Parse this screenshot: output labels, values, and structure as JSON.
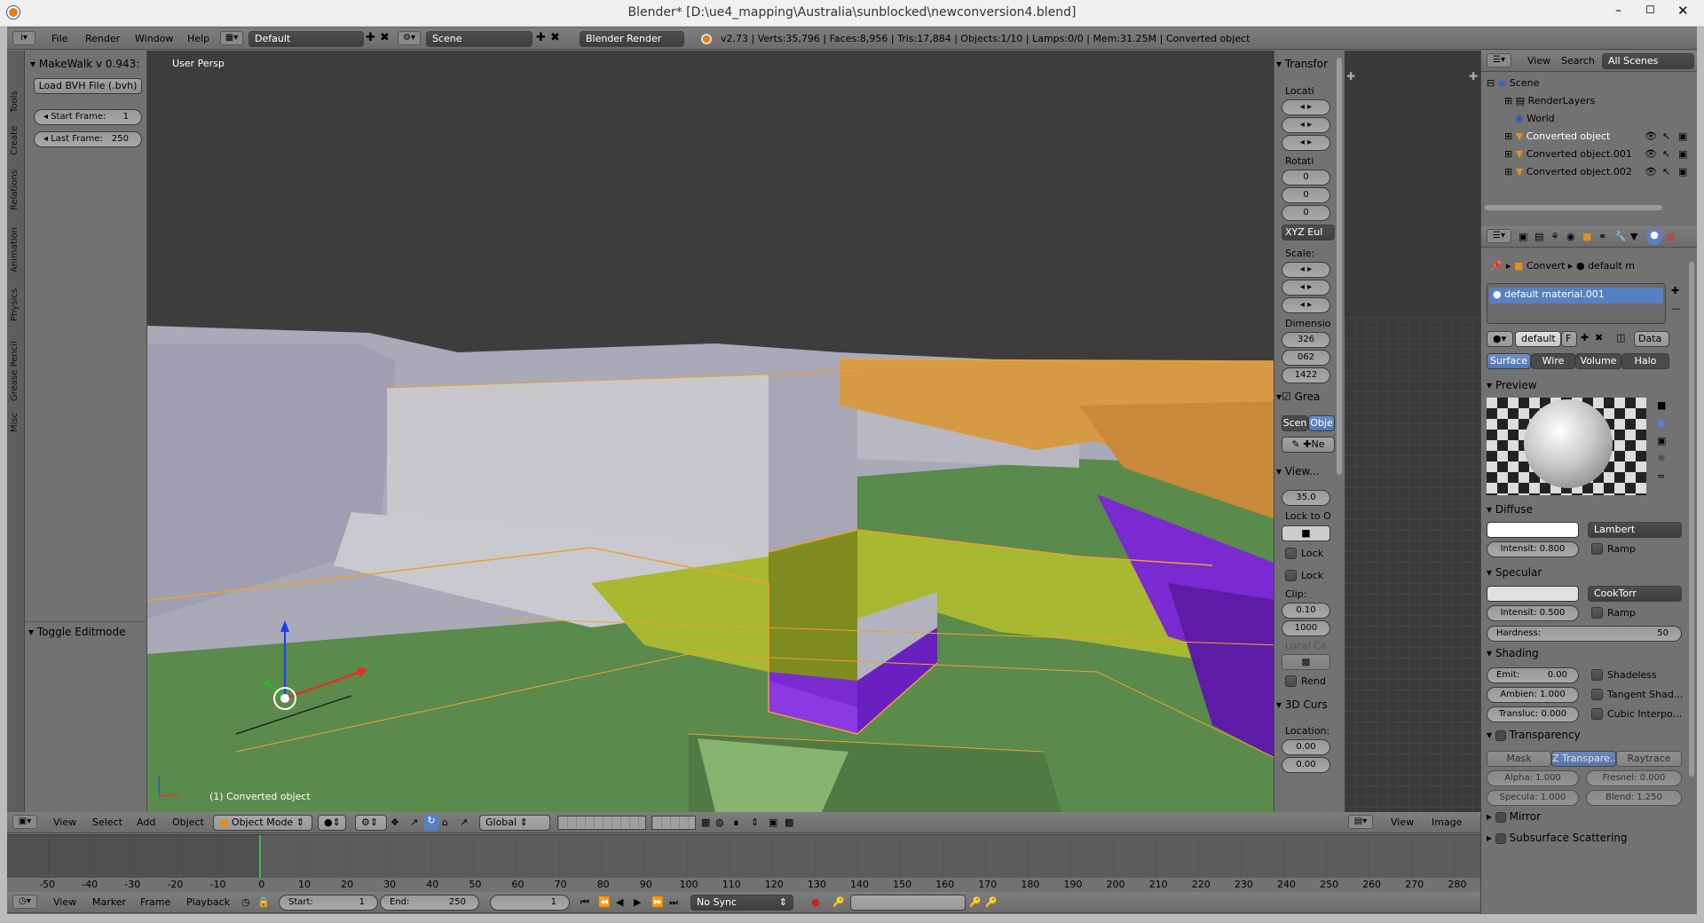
{
  "window": {
    "title": "Blender* [D:\\ue4_mapping\\Australia\\sunblocked\\newconversion4.blend]"
  },
  "info_bar": {
    "menus": [
      "File",
      "Render",
      "Window",
      "Help"
    ],
    "layout": "Default",
    "scene": "Scene",
    "engine": "Blender Render",
    "stats": "v2.73 | Verts:35,796 | Faces:8,956 | Tris:17,884 | Objects:1/10 | Lamps:0/0 | Mem:31.25M | Converted object"
  },
  "toolshelf": {
    "tabs": [
      "Tools",
      "Create",
      "Relations",
      "Animation",
      "Physics",
      "Grease Pencil",
      "Misc"
    ],
    "panel_title": "MakeWalk v 0.943:",
    "load_button": "Load BVH File (.bvh)",
    "start_frame_label": "Start Frame:",
    "start_frame": "1",
    "last_frame_label": "Last Frame:",
    "last_frame": "250",
    "toggle_editmode": "Toggle Editmode"
  },
  "viewport": {
    "view_name": "User Persp",
    "object_label": "(1) Converted object"
  },
  "n_panel": {
    "transform": "Transfor",
    "location": "Locati",
    "rotation": "Rotati",
    "rot_values": [
      "0",
      "0",
      "0"
    ],
    "rot_mode": "XYZ Eul",
    "scale": "Scale:",
    "dimensions": "Dimensio",
    "dim_values": [
      "326",
      "062",
      "1422"
    ],
    "grease": "Grea",
    "scene_btn": "Scen",
    "object_btn": "Obje",
    "new_btn": "Ne",
    "view": "View...",
    "lens": "35.0",
    "lock_to": "Lock to O",
    "lock1": "Lock",
    "lock2": "Lock",
    "clip": "Clip:",
    "clip_start": "0.10",
    "clip_end": "1000",
    "local_cam": "Local Ca",
    "render": "Rend",
    "cursor": "3D Curs",
    "cursor_location": "Location:",
    "cursor_values": [
      "0.00",
      "0.00"
    ]
  },
  "view3d_header": {
    "menus": [
      "View",
      "Select",
      "Add",
      "Object"
    ],
    "mode": "Object Mode",
    "orientation": "Global"
  },
  "image_header": {
    "menus": [
      "View",
      "Image"
    ]
  },
  "outliner": {
    "menus": [
      "View",
      "Search"
    ],
    "filter": "All Scenes",
    "items": [
      "Scene",
      "RenderLayers",
      "World",
      "Converted object",
      "Converted object.001",
      "Converted object.002"
    ]
  },
  "properties": {
    "breadcrumb_obj": "Convert",
    "breadcrumb_mat": "default m",
    "material_slot": "default material.001",
    "material_name": "default",
    "fake_user": "F",
    "data_link": "Data",
    "tabs": [
      "Surface",
      "Wire",
      "Volume",
      "Halo"
    ],
    "preview": "Preview",
    "diffuse": "Diffuse",
    "diffuse_shader": "Lambert",
    "diffuse_intensity": "Intensit: 0.800",
    "ramp": "Ramp",
    "specular": "Specular",
    "specular_shader": "CookTorr",
    "specular_intensity": "Intensit: 0.500",
    "hardness_label": "Hardness:",
    "hardness": "50",
    "shading": "Shading",
    "emit": "Emit:",
    "emit_val": "0.00",
    "shadeless": "Shadeless",
    "ambient": "Ambien: 1.000",
    "tangent": "Tangent Shad...",
    "translucency": "Transluc: 0.000",
    "cubic": "Cubic Interpo...",
    "transparency": "Transparency",
    "trans_tabs": [
      "Mask",
      "Z Transpare...",
      "Raytrace"
    ],
    "alpha": "Alpha:  1.000",
    "fresnel": "Fresnel: 0.000",
    "specular_t": "Specula: 1.000",
    "blend": "Blend:  1.250",
    "mirror": "Mirror",
    "sss": "Subsurface Scattering"
  },
  "timeline": {
    "ticks": [
      "-50",
      "-40",
      "-30",
      "-20",
      "-10",
      "0",
      "10",
      "20",
      "30",
      "40",
      "50",
      "60",
      "70",
      "80",
      "90",
      "100",
      "110",
      "120",
      "130",
      "140",
      "150",
      "160",
      "170",
      "180",
      "190",
      "200",
      "210",
      "220",
      "230",
      "240",
      "250",
      "260",
      "270",
      "280"
    ],
    "menus": [
      "View",
      "Marker",
      "Frame",
      "Playback"
    ],
    "start_label": "Start:",
    "start": "1",
    "end_label": "End:",
    "end": "250",
    "current": "1",
    "sync": "No Sync"
  },
  "colors": {
    "selected_outline": "#f0a030",
    "floor": "#5a8a4c",
    "wall_grey": "#a8a8b8",
    "yellow": "#a8b830",
    "purple": "#7a2ad0",
    "orange": "#d69a45"
  }
}
